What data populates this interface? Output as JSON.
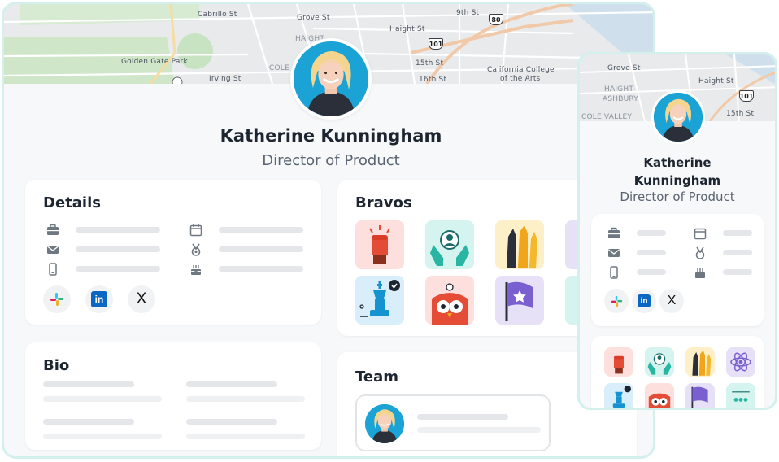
{
  "map": {
    "labels": [
      "Cabrillo St",
      "Grove St",
      "Haight St",
      "9th St",
      "Golden Gate Park",
      "Irving St",
      "HAIGHT-",
      "15th St",
      "16th St",
      "California College",
      "of the Arts",
      "COLE"
    ],
    "highways": [
      "101",
      "80"
    ]
  },
  "profile": {
    "name": "Katherine Kunningham",
    "title": "Director of Product"
  },
  "details": {
    "title": "Details"
  },
  "bio": {
    "title": "Bio"
  },
  "bravos": {
    "title": "Bravos"
  },
  "team": {
    "title": "Team"
  },
  "social": {
    "linkedin_glyph": "in",
    "x_glyph": "X"
  },
  "mobile": {
    "map_labels": [
      "Grove St",
      "HAIGHT-",
      "ASHBURY",
      "Haight St",
      "COLE VALLEY",
      "15th St"
    ],
    "highway": "101",
    "name_line1": "Katherine",
    "name_line2": "Kunningham",
    "title": "Director of Product"
  },
  "colors": {
    "accent_border": "#d3f0ec",
    "avatar_bg": "#1ba3d6",
    "tile_red": "#fde0dd",
    "tile_teal": "#d5f3ef",
    "tile_yellow": "#fdf0c8",
    "tile_purple": "#e6e1f6",
    "tile_blue": "#d8eefb"
  }
}
